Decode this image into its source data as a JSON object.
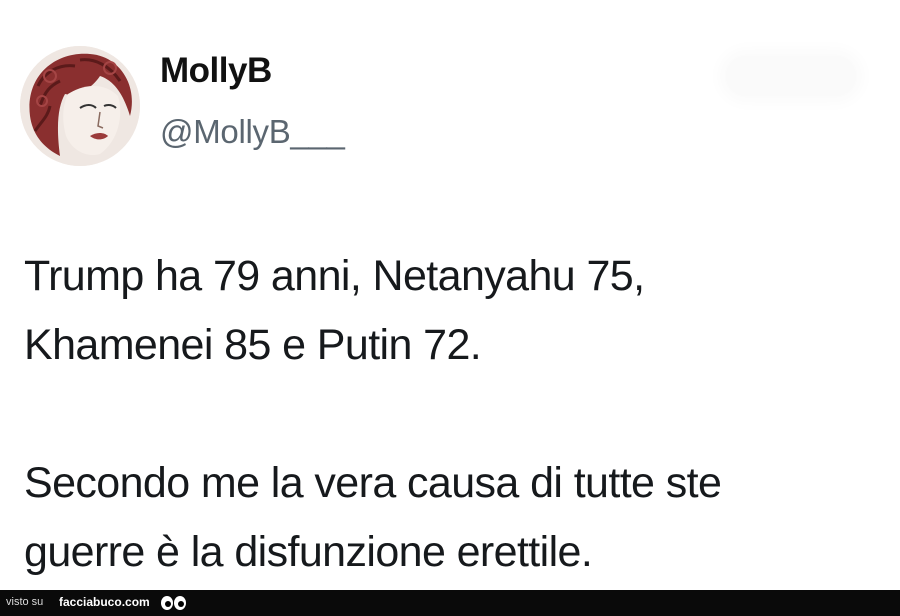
{
  "tweet": {
    "display_name": "MollyB",
    "handle": "@MollyB___",
    "text_lines": [
      "Trump ha 79 anni, Netanyahu 75,",
      "Khamenei 85 e Putin 72.",
      "Secondo me la vera causa di tutte ste",
      "guerre è la disfunzione erettile."
    ]
  },
  "footer": {
    "prefix": "visto su",
    "site": "facciabuco.com",
    "logo_icon": "eyes-icon"
  }
}
